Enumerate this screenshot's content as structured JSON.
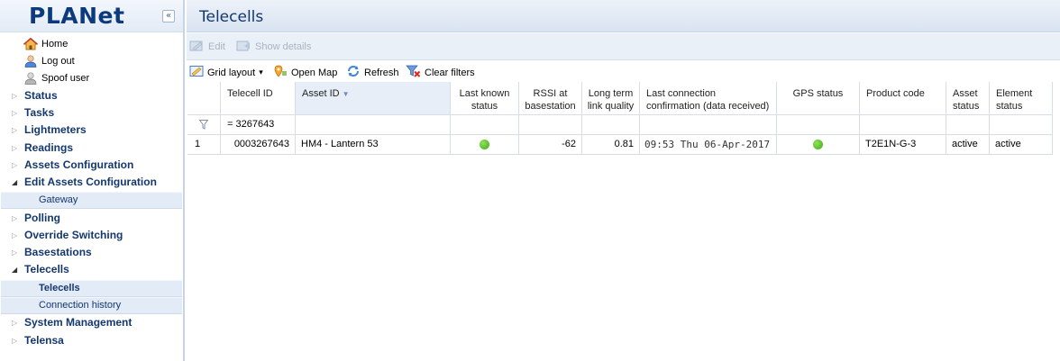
{
  "app": {
    "logo": "PLANet",
    "collapse_glyph": "«"
  },
  "quick_links": [
    {
      "label": "Home",
      "icon": "home-icon"
    },
    {
      "label": "Log out",
      "icon": "user-icon"
    },
    {
      "label": "Spoof user",
      "icon": "user-grey-icon"
    }
  ],
  "nav": [
    {
      "label": "Status"
    },
    {
      "label": "Tasks"
    },
    {
      "label": "Lightmeters"
    },
    {
      "label": "Readings"
    },
    {
      "label": "Assets Configuration"
    },
    {
      "label": "Edit Assets Configuration",
      "children": [
        {
          "label": "Gateway"
        }
      ]
    },
    {
      "label": "Polling"
    },
    {
      "label": "Override Switching"
    },
    {
      "label": "Basestations"
    },
    {
      "label": "Telecells",
      "children": [
        {
          "label": "Telecells"
        },
        {
          "label": "Connection history"
        }
      ]
    },
    {
      "label": "System Management"
    },
    {
      "label": "Telensa"
    }
  ],
  "page": {
    "title": "Telecells"
  },
  "toolbar": {
    "edit_label": "Edit",
    "show_details_label": "Show details",
    "grid_layout_label": "Grid layout",
    "grid_layout_arrow": "▾",
    "open_map_label": "Open Map",
    "refresh_label": "Refresh",
    "clear_filters_label": "Clear filters"
  },
  "grid": {
    "columns": [
      {
        "id": "num",
        "label": ""
      },
      {
        "id": "telecell_id",
        "label": "Telecell ID"
      },
      {
        "id": "asset_id",
        "label": "Asset ID",
        "sorted": "desc"
      },
      {
        "id": "last_known_status",
        "label": "Last known status"
      },
      {
        "id": "rssi",
        "label": "RSSI at basestation"
      },
      {
        "id": "link_quality",
        "label": "Long term link quality"
      },
      {
        "id": "last_conn",
        "label": "Last connection confirmation (data received)"
      },
      {
        "id": "gps",
        "label": "GPS status"
      },
      {
        "id": "product_code",
        "label": "Product code"
      },
      {
        "id": "asset_status",
        "label": "Asset status"
      },
      {
        "id": "element_status",
        "label": "Element status"
      }
    ],
    "filter": {
      "telecell_id": "= 3267643"
    },
    "rows": [
      {
        "num": "1",
        "telecell_id": "0003267643",
        "asset_id": "HM4 - Lantern 53",
        "last_known_status": "green",
        "rssi": "-62",
        "link_quality": "0.81",
        "last_conn": "09:53 Thu 06-Apr-2017",
        "gps": "green",
        "product_code": "T2E1N-G-3",
        "asset_status": "active",
        "element_status": "active"
      }
    ]
  },
  "colors": {
    "nav_text": "#14376e",
    "status_ok": "#3faa14",
    "header_bg": "#e3ebf6"
  }
}
